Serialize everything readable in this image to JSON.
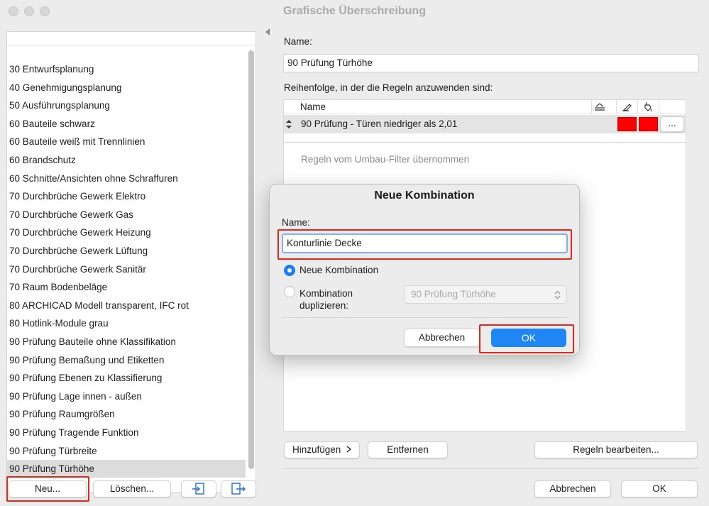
{
  "window": {
    "title": "Grafische Überschreibung"
  },
  "combinations": {
    "items": [
      "30 Entwurfsplanung",
      "40 Genehmigungsplanung",
      "50 Ausführungsplanung",
      "60 Bauteile schwarz",
      "60 Bauteile weiß mit Trennlinien",
      "60 Brandschutz",
      "60 Schnitte/Ansichten ohne Schraffuren",
      "70 Durchbrüche Gewerk Elektro",
      "70 Durchbrüche Gewerk Gas",
      "70 Durchbrüche Gewerk Heizung",
      "70 Durchbrüche Gewerk Lüftung",
      "70 Durchbrüche Gewerk Sanitär",
      "70 Raum Bodenbeläge",
      "80 ARCHICAD Modell transparent, IFC rot",
      "80 Hotlink-Module grau",
      "90 Prüfung Bauteile ohne Klassifikation",
      "90 Prüfung Bemaßung und Etiketten",
      "90 Prüfung Ebenen zu Klassifierung",
      "90 Prüfung Lage innen - außen",
      "90 Prüfung Raumgrößen",
      "90 Prüfung Tragende Funktion",
      "90 Prüfung Türbreite",
      "90 Prüfung Türhöhe"
    ],
    "selected": "90 Prüfung Türhöhe",
    "new_button": "Neu...",
    "delete_button": "Löschen..."
  },
  "details": {
    "name_label": "Name:",
    "name_value": "90 Prüfung Türhöhe",
    "order_label": "Reihenfolge, in der die Regeln anzuwenden sind:",
    "rules_column_name": "Name",
    "rules": [
      {
        "name": "90 Prüfung - Türen niedriger als 2,01",
        "color1": "#ff0000",
        "color2": "#ff0000",
        "more": "..."
      }
    ],
    "rules_hint": "Regeln vom Umbau-Filter übernommen",
    "add_button": "Hinzufügen",
    "remove_button": "Entfernen",
    "edit_rules_button": "Regeln bearbeiten...",
    "cancel_button": "Abbrechen",
    "ok_button": "OK"
  },
  "dialog": {
    "title": "Neue Kombination",
    "name_label": "Name:",
    "name_value": "Konturlinie Decke",
    "option_new": "Neue Kombination",
    "option_duplicate_line1": "Kombination",
    "option_duplicate_line2": "duplizieren:",
    "duplicate_source": "90 Prüfung Türhöhe",
    "cancel_button": "Abbrechen",
    "ok_button": "OK"
  },
  "colors": {
    "highlight": "#e5261b",
    "accent": "#1f86f4"
  }
}
